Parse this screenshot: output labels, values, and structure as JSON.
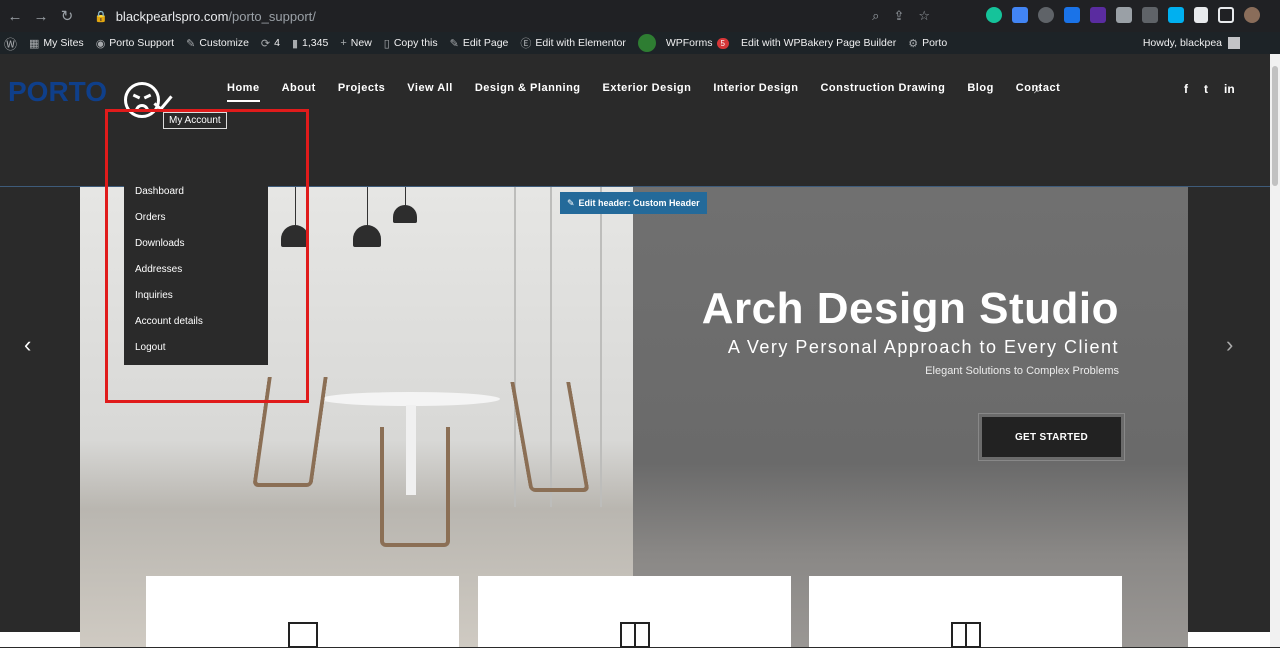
{
  "browser": {
    "url_host": "blackpearlspro.com",
    "url_path": "/porto_support/",
    "back": "←",
    "forward": "→",
    "reload": "↻"
  },
  "wp_admin_bar": {
    "items": [
      {
        "label": "My Sites",
        "icon": "sites-icon"
      },
      {
        "label": "Porto Support",
        "icon": "dashboard-icon"
      },
      {
        "label": "Customize",
        "icon": "brush-icon"
      },
      {
        "label": "4",
        "icon": "updates-icon"
      },
      {
        "label": "1,345",
        "icon": "comments-icon"
      },
      {
        "label": "New",
        "icon": "plus-icon"
      },
      {
        "label": "Copy this",
        "icon": "copy-icon"
      },
      {
        "label": "Edit Page",
        "icon": "pencil-icon"
      },
      {
        "label": "Edit with Elementor",
        "icon": "elementor-icon"
      }
    ],
    "wpforms_label": "WPForms",
    "wpforms_count": "5",
    "wpbakery_label": "Edit with WPBakery Page Builder",
    "porto_label": "Porto",
    "howdy": "Howdy, blackpea"
  },
  "header": {
    "logo": "PORTO",
    "nav": [
      "Home",
      "About",
      "Projects",
      "View All",
      "Design & Planning",
      "Exterior Design",
      "Interior Design",
      "Construction Drawing",
      "Blog",
      "Contact"
    ],
    "social": [
      "f",
      "t",
      "in"
    ]
  },
  "account": {
    "tooltip": "My Account",
    "menu": [
      "Dashboard",
      "Orders",
      "Downloads",
      "Addresses",
      "Inquiries",
      "Account details",
      "Logout"
    ]
  },
  "hero": {
    "edit_header": "Edit header: Custom Header",
    "title": "Arch Design Studio",
    "subtitle": "A Very Personal Approach to Every Client",
    "tagline": "Elegant Solutions to Complex Problems",
    "cta": "GET STARTED",
    "prev": "‹",
    "next": "›"
  },
  "colors": {
    "accent_red": "#e01b1b",
    "edit_blue": "#246a9a",
    "logo_blue": "#0f3f8a"
  }
}
